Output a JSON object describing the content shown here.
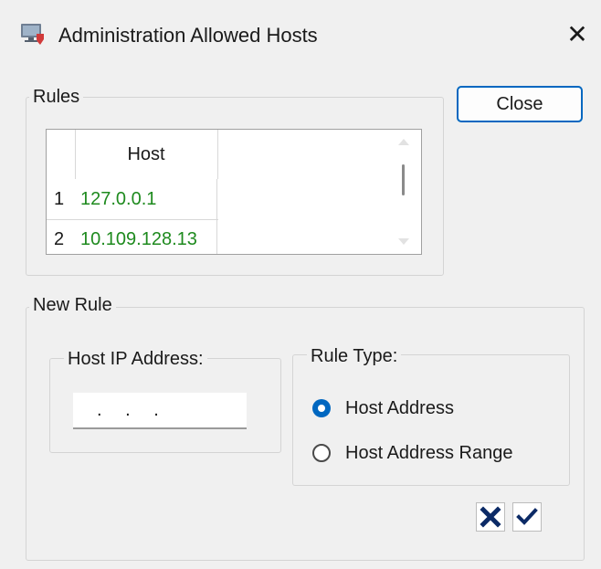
{
  "window": {
    "title": "Administration Allowed Hosts",
    "app_icon": "computer-shield-icon",
    "close_icon": "close-icon",
    "close_glyph": "✕"
  },
  "rules": {
    "group_label": "Rules",
    "column_header": "Host",
    "rows": [
      {
        "num": "1",
        "host": "127.0.0.1"
      },
      {
        "num": "2",
        "host": "10.109.128.13"
      }
    ],
    "host_text_color": "#1e8a1e"
  },
  "close_button": {
    "label": "Close",
    "accent": "#0067c0"
  },
  "new_rule": {
    "group_label": "New Rule",
    "host_ip": {
      "label": "Host IP Address:",
      "value": " . . ."
    },
    "rule_type": {
      "label": "Rule Type:",
      "options": [
        {
          "label": "Host Address",
          "selected": true
        },
        {
          "label": "Host Address Range",
          "selected": false
        }
      ]
    },
    "cancel_icon": "x-mark-icon",
    "confirm_icon": "check-mark-icon",
    "icon_color": "#0b2a66"
  }
}
